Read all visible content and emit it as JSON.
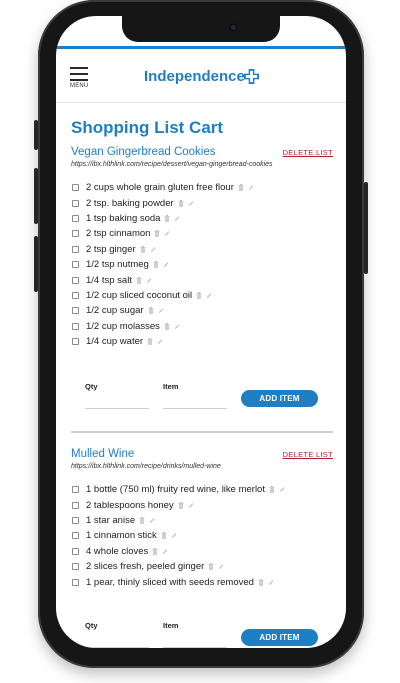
{
  "app": {
    "brand": "Independence",
    "menu_label": "MENU"
  },
  "page": {
    "title": "Shopping List Cart"
  },
  "form": {
    "qty_label": "Qty",
    "item_label": "Item",
    "add_label": "ADD ITEM",
    "delete_label": "DELETE LIST"
  },
  "recipes": [
    {
      "name": "Vegan Gingerbread Cookies",
      "url": "https://ibx.hlthlink.com/recipe/dessert/vegan-gingerbread-cookies",
      "items": [
        "2 cups whole grain gluten free flour",
        "2 tsp. baking powder",
        "1 tsp baking soda",
        "2 tsp cinnamon",
        "2 tsp ginger",
        "1/2 tsp nutmeg",
        "1/4 tsp salt",
        "1/2 cup sliced coconut oil",
        "1/2 cup sugar",
        "1/2 cup molasses",
        "1/4 cup water"
      ]
    },
    {
      "name": "Mulled Wine",
      "url": "https://ibx.hlthlink.com/recipe/drinks/mulled-wine",
      "items": [
        "1 bottle (750 ml) fruity red wine, like merlot",
        "2 tablespoons honey",
        "1 star anise",
        "1 cinnamon stick",
        "4 whole cloves",
        "2 slices fresh, peeled ginger",
        "1 pear, thinly sliced with seeds removed"
      ]
    }
  ],
  "colors": {
    "brand": "#1f7fc4",
    "delete": "#b21f2d"
  }
}
